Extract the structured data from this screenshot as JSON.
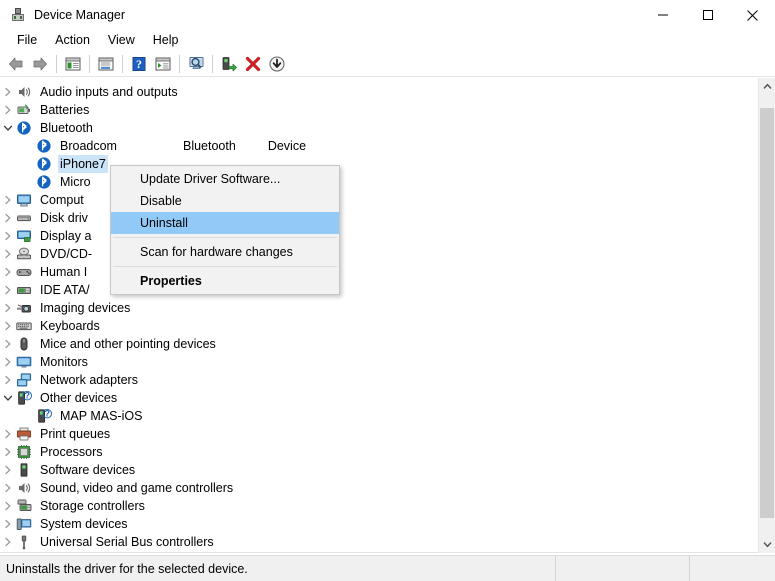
{
  "window": {
    "title": "Device Manager",
    "icon": "device-manager-icon",
    "controls": {
      "minimize": "minimize-icon",
      "maximize": "maximize-icon",
      "close": "close-icon"
    }
  },
  "menubar": {
    "items": [
      {
        "label": "File"
      },
      {
        "label": "Action"
      },
      {
        "label": "View"
      },
      {
        "label": "Help"
      }
    ]
  },
  "toolbar": {
    "buttons": [
      {
        "name": "back-icon"
      },
      {
        "name": "forward-icon"
      },
      {
        "name": "separator"
      },
      {
        "name": "show-hide-console-tree-icon"
      },
      {
        "name": "separator"
      },
      {
        "name": "properties-window-icon"
      },
      {
        "name": "separator"
      },
      {
        "name": "help-icon"
      },
      {
        "name": "properties-icon"
      },
      {
        "name": "separator"
      },
      {
        "name": "scan-for-hardware-changes-icon"
      },
      {
        "name": "separator"
      },
      {
        "name": "update-driver-software-icon"
      },
      {
        "name": "uninstall-icon"
      },
      {
        "name": "disable-icon"
      }
    ]
  },
  "tree": {
    "nodes": [
      {
        "label": "Audio inputs and outputs",
        "icon": "speaker-icon",
        "level": 1,
        "twisty": "collapsed",
        "selected": false
      },
      {
        "label": "Batteries",
        "icon": "battery-icon",
        "level": 1,
        "twisty": "collapsed",
        "selected": false
      },
      {
        "label": "Bluetooth",
        "icon": "bluetooth-icon",
        "level": 1,
        "twisty": "expanded",
        "selected": false
      },
      {
        "label": "Broadcom",
        "label2": "Bluetooth",
        "label3": "Device",
        "icon": "bluetooth-icon",
        "level": 2,
        "twisty": "none",
        "selected": false
      },
      {
        "label": "iPhone7",
        "icon": "bluetooth-icon",
        "level": 2,
        "twisty": "none",
        "selected": true
      },
      {
        "label": "Micro",
        "icon": "bluetooth-icon",
        "level": 2,
        "twisty": "none",
        "selected": false
      },
      {
        "label": "Comput",
        "icon": "computer-icon",
        "level": 1,
        "twisty": "collapsed",
        "selected": false
      },
      {
        "label": "Disk driv",
        "icon": "disk-drive-icon",
        "level": 1,
        "twisty": "collapsed",
        "selected": false
      },
      {
        "label": "Display a",
        "icon": "display-adapter-icon",
        "level": 1,
        "twisty": "collapsed",
        "selected": false
      },
      {
        "label": "DVD/CD-",
        "icon": "dvd-drive-icon",
        "level": 1,
        "twisty": "collapsed",
        "selected": false
      },
      {
        "label": "Human I",
        "icon": "hid-icon",
        "level": 1,
        "twisty": "collapsed",
        "selected": false
      },
      {
        "label": "IDE ATA/",
        "icon": "ide-controller-icon",
        "level": 1,
        "twisty": "collapsed",
        "selected": false
      },
      {
        "label": "Imaging devices",
        "icon": "imaging-device-icon",
        "level": 1,
        "twisty": "collapsed",
        "selected": false
      },
      {
        "label": "Keyboards",
        "icon": "keyboard-icon",
        "level": 1,
        "twisty": "collapsed",
        "selected": false
      },
      {
        "label": "Mice and other pointing devices",
        "icon": "mouse-icon",
        "level": 1,
        "twisty": "collapsed",
        "selected": false
      },
      {
        "label": "Monitors",
        "icon": "monitor-icon",
        "level": 1,
        "twisty": "collapsed",
        "selected": false
      },
      {
        "label": "Network adapters",
        "icon": "network-adapter-icon",
        "level": 1,
        "twisty": "collapsed",
        "selected": false
      },
      {
        "label": "Other devices",
        "icon": "unknown-device-icon",
        "level": 1,
        "twisty": "expanded",
        "selected": false
      },
      {
        "label": "MAP MAS-iOS",
        "icon": "unknown-device-icon",
        "level": 2,
        "twisty": "none",
        "selected": false
      },
      {
        "label": "Print queues",
        "icon": "printer-icon",
        "level": 1,
        "twisty": "collapsed",
        "selected": false
      },
      {
        "label": "Processors",
        "icon": "processor-icon",
        "level": 1,
        "twisty": "collapsed",
        "selected": false
      },
      {
        "label": "Software devices",
        "icon": "software-device-icon",
        "level": 1,
        "twisty": "collapsed",
        "selected": false
      },
      {
        "label": "Sound, video and game controllers",
        "icon": "speaker-icon",
        "level": 1,
        "twisty": "collapsed",
        "selected": false
      },
      {
        "label": "Storage controllers",
        "icon": "storage-controller-icon",
        "level": 1,
        "twisty": "collapsed",
        "selected": false
      },
      {
        "label": "System devices",
        "icon": "system-device-icon",
        "level": 1,
        "twisty": "collapsed",
        "selected": false
      },
      {
        "label": "Universal Serial Bus controllers",
        "icon": "usb-icon",
        "level": 1,
        "twisty": "collapsed",
        "selected": false
      }
    ]
  },
  "context_menu": {
    "items": [
      {
        "label": "Update Driver Software...",
        "highlighted": false,
        "bold": false
      },
      {
        "label": "Disable",
        "highlighted": false,
        "bold": false
      },
      {
        "label": "Uninstall",
        "highlighted": true,
        "bold": false
      },
      {
        "separator": true
      },
      {
        "label": "Scan for hardware changes",
        "highlighted": false,
        "bold": false
      },
      {
        "separator": true
      },
      {
        "label": "Properties",
        "highlighted": false,
        "bold": true
      }
    ]
  },
  "statusbar": {
    "message": "Uninstalls the driver for the selected device.",
    "panel2": "",
    "panel3": ""
  },
  "scrollbar": {
    "up": "scroll-up-icon",
    "down": "scroll-down-icon"
  },
  "colors": {
    "selection": "#cce4f7",
    "menu_highlight": "#91c9f7",
    "window_bg": "#ffffff",
    "status_bg": "#f0f0f0"
  }
}
